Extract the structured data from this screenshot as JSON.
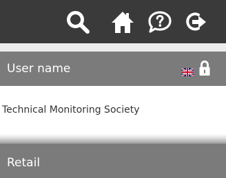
{
  "toolbar": {
    "icons": [
      "search-icon",
      "home-icon",
      "chat-help-icon",
      "logout-icon"
    ]
  },
  "user": {
    "label": "User name",
    "flag_icon": "uk-flag-icon",
    "lock_icon": "lock-icon"
  },
  "organization": {
    "name": "Technical Monitoring Society"
  },
  "section": {
    "label": "Retail"
  },
  "colors": {
    "topbar": "#3a3a3a",
    "bar": "#7b7b7b",
    "bar_text": "#ffffff",
    "body_text": "#333333"
  }
}
